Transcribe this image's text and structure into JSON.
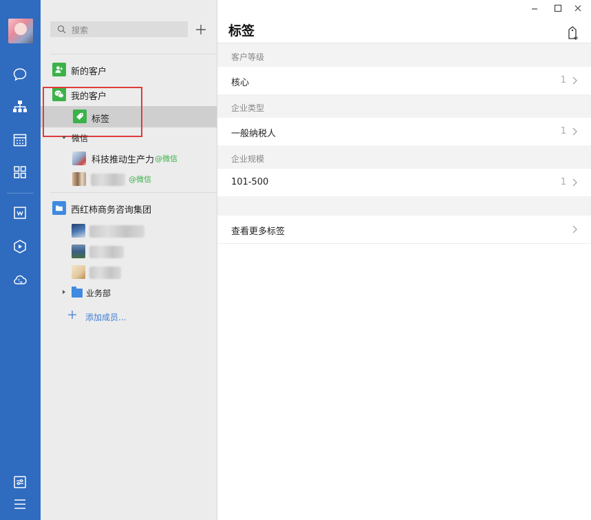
{
  "rail": {
    "icons": [
      "chat-icon",
      "org-chart-icon",
      "calendar-icon",
      "apps-icon",
      "document-icon",
      "drive-icon",
      "cloud-call-icon",
      "settings-icon",
      "menu-icon"
    ]
  },
  "search": {
    "placeholder": "搜索"
  },
  "contacts": {
    "new_customers": "新的客户",
    "my_customers": "我的客户",
    "tags": "标签",
    "wechat_group": "微信",
    "wechat_contacts": [
      {
        "name": "科技推动生产力",
        "source": "@微信"
      },
      {
        "name": "",
        "source": "@微信"
      }
    ],
    "company": "西红柿商务咨询集团",
    "department": "业务部",
    "add_member": "添加成员..."
  },
  "main": {
    "title": "标签",
    "groups": [
      {
        "header": "客户等级",
        "items": [
          {
            "label": "核心",
            "count": "1"
          }
        ]
      },
      {
        "header": "企业类型",
        "items": [
          {
            "label": "一般纳税人",
            "count": "1"
          }
        ]
      },
      {
        "header": "企业规模",
        "items": [
          {
            "label": "101-500",
            "count": "1"
          }
        ]
      }
    ],
    "more_tags": "查看更多标签"
  },
  "colors": {
    "rail": "#2f6bbf",
    "highlight_box": "#e03a3a",
    "wechat_green": "#3cb24a",
    "link_blue": "#3f7dd1"
  }
}
